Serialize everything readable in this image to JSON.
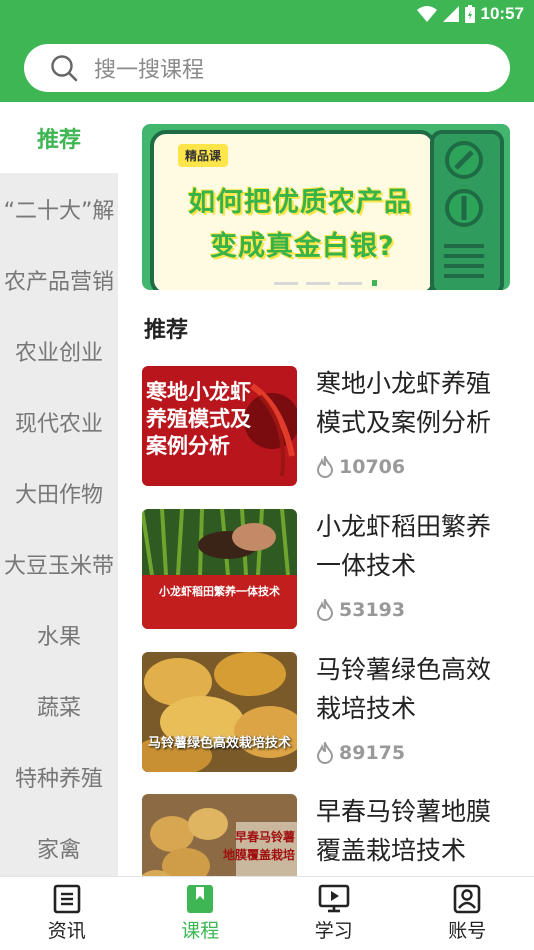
{
  "status": {
    "time": "10:57"
  },
  "search": {
    "placeholder": "搜一搜课程"
  },
  "sidebar": {
    "items": [
      {
        "label": "推荐",
        "active": true
      },
      {
        "label": "“二十大”解"
      },
      {
        "label": "农产品营销"
      },
      {
        "label": "农业创业"
      },
      {
        "label": "现代农业"
      },
      {
        "label": "大田作物"
      },
      {
        "label": "大豆玉米带"
      },
      {
        "label": "水果"
      },
      {
        "label": "蔬菜"
      },
      {
        "label": "特种养殖"
      },
      {
        "label": "家禽"
      }
    ]
  },
  "banner": {
    "tag": "精品课",
    "line1": "如何把优质农产品",
    "line2": "变成真金白银?"
  },
  "section": {
    "title": "推荐"
  },
  "courses": [
    {
      "title": "寒地小龙虾养殖模式及案例分析",
      "views": "10706",
      "thumb_text": [
        "寒地小龙虾",
        "养殖模式及",
        "案例分析"
      ]
    },
    {
      "title": "小龙虾稻田繁养一体技术",
      "views": "53193",
      "thumb_text": [
        "小龙虾稻田繁养一体技术"
      ]
    },
    {
      "title": "马铃薯绿色高效栽培技术",
      "views": "89175",
      "thumb_text": [
        "马铃薯绿色高效栽培技术"
      ]
    },
    {
      "title": "早春马铃薯地膜覆盖栽培技术",
      "views": "",
      "thumb_text": [
        "早春马铃薯",
        "地膜覆盖栽培"
      ]
    }
  ],
  "tabs": [
    {
      "label": "资讯",
      "icon": "news-icon"
    },
    {
      "label": "课程",
      "icon": "bookmark-icon",
      "active": true
    },
    {
      "label": "学习",
      "icon": "play-screen-icon"
    },
    {
      "label": "账号",
      "icon": "account-icon"
    }
  ],
  "colors": {
    "accent": "#3db653",
    "sidebar_bg": "#ececec",
    "banner_yellow": "#fde54a"
  }
}
